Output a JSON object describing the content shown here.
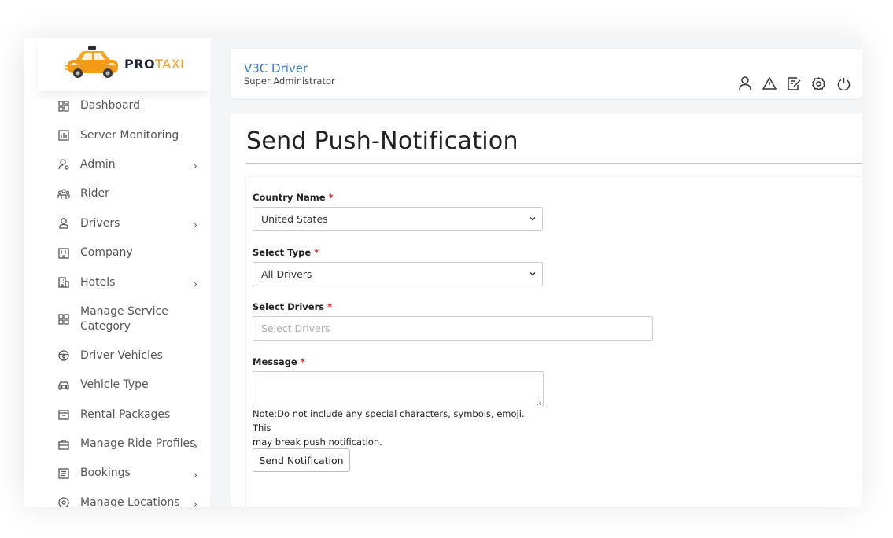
{
  "brand": {
    "pro": "PRO",
    "taxi": "TAXI",
    "accent": "#f2a021"
  },
  "sidebar": {
    "items": [
      {
        "label": "Dashboard",
        "icon": "dashboard-grid-icon",
        "submenu": false
      },
      {
        "label": "Server Monitoring",
        "icon": "chart-icon",
        "submenu": false
      },
      {
        "label": "Admin",
        "icon": "admin-user-icon",
        "submenu": true
      },
      {
        "label": "Rider",
        "icon": "riders-group-icon",
        "submenu": false
      },
      {
        "label": "Drivers",
        "icon": "driver-icon",
        "submenu": true
      },
      {
        "label": "Company",
        "icon": "building-icon",
        "submenu": false
      },
      {
        "label": "Hotels",
        "icon": "hotel-icon",
        "submenu": true
      },
      {
        "label": "Manage Service Category",
        "icon": "category-grid-icon",
        "submenu": false
      },
      {
        "label": "Driver Vehicles",
        "icon": "steering-wheel-icon",
        "submenu": false
      },
      {
        "label": "Vehicle Type",
        "icon": "car-icon",
        "submenu": false
      },
      {
        "label": "Rental Packages",
        "icon": "package-icon",
        "submenu": false
      },
      {
        "label": "Manage Ride Profiles",
        "icon": "briefcase-icon",
        "submenu": true
      },
      {
        "label": "Bookings",
        "icon": "bookings-list-icon",
        "submenu": true
      },
      {
        "label": "Manage Locations",
        "icon": "location-pin-icon",
        "submenu": true
      }
    ]
  },
  "header": {
    "title": "V3C Driver",
    "subtitle": "Super Administrator",
    "icons": [
      "user-icon",
      "warning-icon",
      "edit-icon",
      "settings-icon",
      "power-icon"
    ]
  },
  "main": {
    "title": "Send Push-Notification",
    "form": {
      "country_label": "Country Name",
      "country_value": "United States",
      "type_label": "Select Type",
      "type_value": "All Drivers",
      "drivers_label": "Select Drivers",
      "drivers_placeholder": "Select Drivers",
      "message_label": "Message",
      "required_mark": "*",
      "note_line1": "Note:Do not include any special characters, symbols, emoji. This",
      "note_line2": "may break push notification.",
      "submit_label": "Send Notification"
    }
  }
}
